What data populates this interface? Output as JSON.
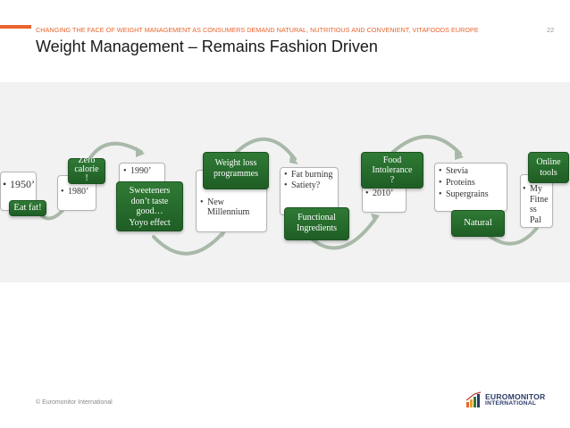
{
  "header": {
    "subtitle": "CHANGING THE FACE OF WEIGHT MANAGEMENT AS CONSUMERS DEMAND NATURAL, NUTRITIOUS AND CONVENIENT, VITAFOODS EUROPE",
    "page_number": "22",
    "title": "Weight Management – Remains Fashion Driven"
  },
  "timeline": {
    "era_1950": {
      "bullets": [
        "1950’"
      ],
      "label": "Eat fat!"
    },
    "era_1980": {
      "bullets": [
        "1980’"
      ],
      "label_line1": "Zero",
      "label_line2": "calorie",
      "label_line3": "!"
    },
    "era_1990": {
      "bullets": [
        "1990’"
      ],
      "label_line1": "Sweeteners",
      "label_line2": "don’t taste",
      "label_line3": "good…",
      "label_line4": "Yoyo effect"
    },
    "era_2000": {
      "bullets": [
        "New Millennium"
      ],
      "label_line1": "Weight loss",
      "label_line2": "programmes"
    },
    "era_fat": {
      "bullets": [
        "Fat burning",
        "Satiety?"
      ],
      "label_line1": "Functional",
      "label_line2": "Ingredients"
    },
    "era_2010": {
      "bullets": [
        "2010’"
      ],
      "label_line1": "Food",
      "label_line2": "Intolerance",
      "label_line3": "?"
    },
    "era_stevia": {
      "bullets": [
        "Stevia",
        "Proteins",
        "Supergrains"
      ],
      "label": "Natural"
    },
    "era_online": {
      "bullets": [
        "My Fitness Pal"
      ],
      "label_line1": "Online",
      "label_line2": "tools"
    }
  },
  "footer": {
    "copyright": "© Euromonitor International",
    "logo_line1": "EUROMONITOR",
    "logo_line2": "INTERNATIONAL"
  },
  "colors": {
    "accent": "#e8642c",
    "green": "#2a6e30",
    "arrow": "#a8b8a8",
    "brand_navy": "#2b3a67"
  }
}
